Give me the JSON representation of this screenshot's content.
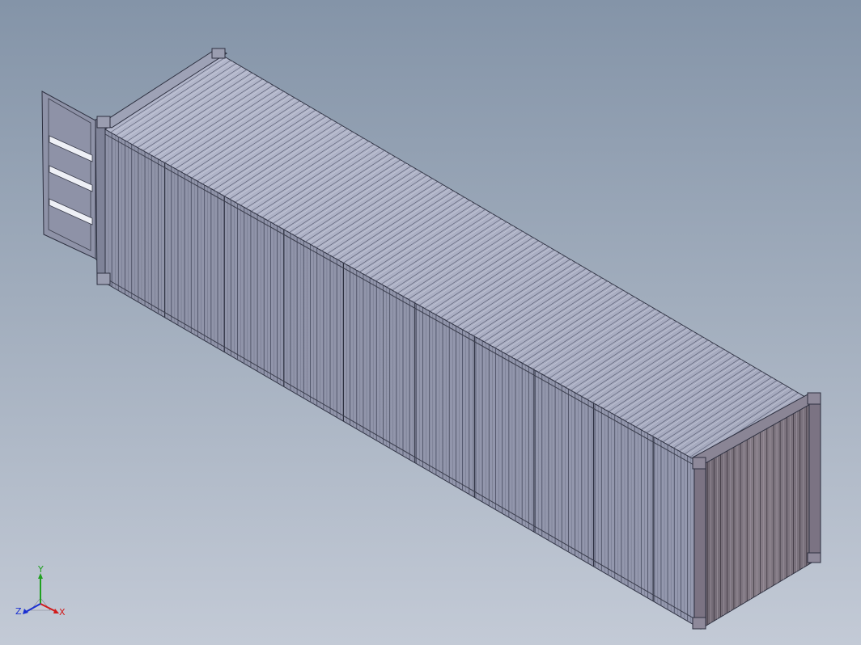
{
  "viewport": {
    "background_top": "#8494a8",
    "background_bottom": "#c3cad6"
  },
  "model": {
    "object": "shipping-container",
    "view": "isometric",
    "body_color": "#9da2b8",
    "end_wall_color": "#7e7580",
    "frame_color": "#8a8595"
  },
  "triad": {
    "x_label": "X",
    "y_label": "Y",
    "z_label": "Z",
    "x_color": "#d11a1a",
    "y_color": "#1fa01f",
    "z_color": "#1a2fd1"
  }
}
